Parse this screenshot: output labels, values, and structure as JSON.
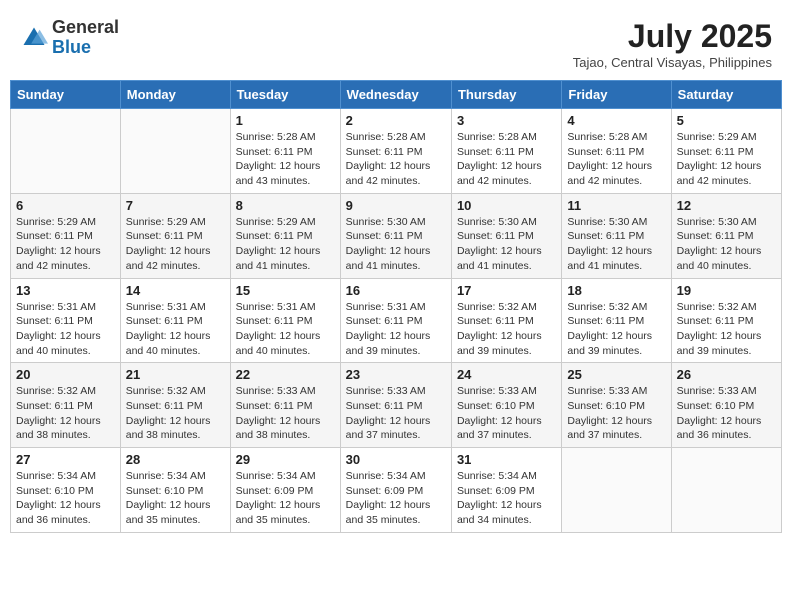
{
  "logo": {
    "text_general": "General",
    "text_blue": "Blue"
  },
  "header": {
    "month_year": "July 2025",
    "location": "Tajao, Central Visayas, Philippines"
  },
  "weekdays": [
    "Sunday",
    "Monday",
    "Tuesday",
    "Wednesday",
    "Thursday",
    "Friday",
    "Saturday"
  ],
  "weeks": [
    [
      {
        "day": "",
        "sunrise": "",
        "sunset": "",
        "daylight": ""
      },
      {
        "day": "",
        "sunrise": "",
        "sunset": "",
        "daylight": ""
      },
      {
        "day": "1",
        "sunrise": "Sunrise: 5:28 AM",
        "sunset": "Sunset: 6:11 PM",
        "daylight": "Daylight: 12 hours and 43 minutes."
      },
      {
        "day": "2",
        "sunrise": "Sunrise: 5:28 AM",
        "sunset": "Sunset: 6:11 PM",
        "daylight": "Daylight: 12 hours and 42 minutes."
      },
      {
        "day": "3",
        "sunrise": "Sunrise: 5:28 AM",
        "sunset": "Sunset: 6:11 PM",
        "daylight": "Daylight: 12 hours and 42 minutes."
      },
      {
        "day": "4",
        "sunrise": "Sunrise: 5:28 AM",
        "sunset": "Sunset: 6:11 PM",
        "daylight": "Daylight: 12 hours and 42 minutes."
      },
      {
        "day": "5",
        "sunrise": "Sunrise: 5:29 AM",
        "sunset": "Sunset: 6:11 PM",
        "daylight": "Daylight: 12 hours and 42 minutes."
      }
    ],
    [
      {
        "day": "6",
        "sunrise": "Sunrise: 5:29 AM",
        "sunset": "Sunset: 6:11 PM",
        "daylight": "Daylight: 12 hours and 42 minutes."
      },
      {
        "day": "7",
        "sunrise": "Sunrise: 5:29 AM",
        "sunset": "Sunset: 6:11 PM",
        "daylight": "Daylight: 12 hours and 42 minutes."
      },
      {
        "day": "8",
        "sunrise": "Sunrise: 5:29 AM",
        "sunset": "Sunset: 6:11 PM",
        "daylight": "Daylight: 12 hours and 41 minutes."
      },
      {
        "day": "9",
        "sunrise": "Sunrise: 5:30 AM",
        "sunset": "Sunset: 6:11 PM",
        "daylight": "Daylight: 12 hours and 41 minutes."
      },
      {
        "day": "10",
        "sunrise": "Sunrise: 5:30 AM",
        "sunset": "Sunset: 6:11 PM",
        "daylight": "Daylight: 12 hours and 41 minutes."
      },
      {
        "day": "11",
        "sunrise": "Sunrise: 5:30 AM",
        "sunset": "Sunset: 6:11 PM",
        "daylight": "Daylight: 12 hours and 41 minutes."
      },
      {
        "day": "12",
        "sunrise": "Sunrise: 5:30 AM",
        "sunset": "Sunset: 6:11 PM",
        "daylight": "Daylight: 12 hours and 40 minutes."
      }
    ],
    [
      {
        "day": "13",
        "sunrise": "Sunrise: 5:31 AM",
        "sunset": "Sunset: 6:11 PM",
        "daylight": "Daylight: 12 hours and 40 minutes."
      },
      {
        "day": "14",
        "sunrise": "Sunrise: 5:31 AM",
        "sunset": "Sunset: 6:11 PM",
        "daylight": "Daylight: 12 hours and 40 minutes."
      },
      {
        "day": "15",
        "sunrise": "Sunrise: 5:31 AM",
        "sunset": "Sunset: 6:11 PM",
        "daylight": "Daylight: 12 hours and 40 minutes."
      },
      {
        "day": "16",
        "sunrise": "Sunrise: 5:31 AM",
        "sunset": "Sunset: 6:11 PM",
        "daylight": "Daylight: 12 hours and 39 minutes."
      },
      {
        "day": "17",
        "sunrise": "Sunrise: 5:32 AM",
        "sunset": "Sunset: 6:11 PM",
        "daylight": "Daylight: 12 hours and 39 minutes."
      },
      {
        "day": "18",
        "sunrise": "Sunrise: 5:32 AM",
        "sunset": "Sunset: 6:11 PM",
        "daylight": "Daylight: 12 hours and 39 minutes."
      },
      {
        "day": "19",
        "sunrise": "Sunrise: 5:32 AM",
        "sunset": "Sunset: 6:11 PM",
        "daylight": "Daylight: 12 hours and 39 minutes."
      }
    ],
    [
      {
        "day": "20",
        "sunrise": "Sunrise: 5:32 AM",
        "sunset": "Sunset: 6:11 PM",
        "daylight": "Daylight: 12 hours and 38 minutes."
      },
      {
        "day": "21",
        "sunrise": "Sunrise: 5:32 AM",
        "sunset": "Sunset: 6:11 PM",
        "daylight": "Daylight: 12 hours and 38 minutes."
      },
      {
        "day": "22",
        "sunrise": "Sunrise: 5:33 AM",
        "sunset": "Sunset: 6:11 PM",
        "daylight": "Daylight: 12 hours and 38 minutes."
      },
      {
        "day": "23",
        "sunrise": "Sunrise: 5:33 AM",
        "sunset": "Sunset: 6:11 PM",
        "daylight": "Daylight: 12 hours and 37 minutes."
      },
      {
        "day": "24",
        "sunrise": "Sunrise: 5:33 AM",
        "sunset": "Sunset: 6:10 PM",
        "daylight": "Daylight: 12 hours and 37 minutes."
      },
      {
        "day": "25",
        "sunrise": "Sunrise: 5:33 AM",
        "sunset": "Sunset: 6:10 PM",
        "daylight": "Daylight: 12 hours and 37 minutes."
      },
      {
        "day": "26",
        "sunrise": "Sunrise: 5:33 AM",
        "sunset": "Sunset: 6:10 PM",
        "daylight": "Daylight: 12 hours and 36 minutes."
      }
    ],
    [
      {
        "day": "27",
        "sunrise": "Sunrise: 5:34 AM",
        "sunset": "Sunset: 6:10 PM",
        "daylight": "Daylight: 12 hours and 36 minutes."
      },
      {
        "day": "28",
        "sunrise": "Sunrise: 5:34 AM",
        "sunset": "Sunset: 6:10 PM",
        "daylight": "Daylight: 12 hours and 35 minutes."
      },
      {
        "day": "29",
        "sunrise": "Sunrise: 5:34 AM",
        "sunset": "Sunset: 6:09 PM",
        "daylight": "Daylight: 12 hours and 35 minutes."
      },
      {
        "day": "30",
        "sunrise": "Sunrise: 5:34 AM",
        "sunset": "Sunset: 6:09 PM",
        "daylight": "Daylight: 12 hours and 35 minutes."
      },
      {
        "day": "31",
        "sunrise": "Sunrise: 5:34 AM",
        "sunset": "Sunset: 6:09 PM",
        "daylight": "Daylight: 12 hours and 34 minutes."
      },
      {
        "day": "",
        "sunrise": "",
        "sunset": "",
        "daylight": ""
      },
      {
        "day": "",
        "sunrise": "",
        "sunset": "",
        "daylight": ""
      }
    ]
  ]
}
